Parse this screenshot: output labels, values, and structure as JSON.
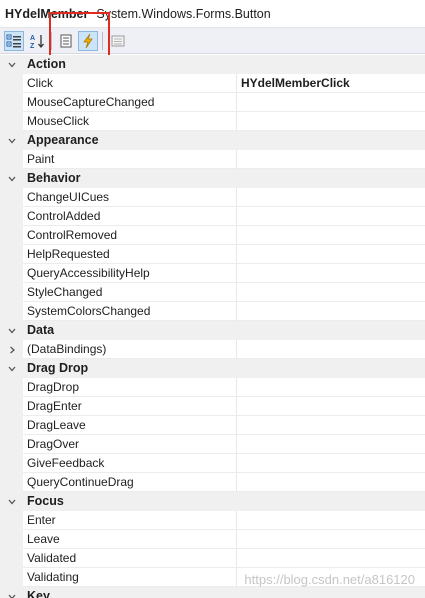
{
  "header": {
    "object_name": "HYdelMember",
    "object_type": "System.Windows.Forms.Button"
  },
  "toolbar": {
    "buttons": [
      {
        "icon": "categorized-icon",
        "checked": true
      },
      {
        "icon": "alphabetical-icon",
        "checked": false
      },
      {
        "icon": "properties-icon",
        "checked": false
      },
      {
        "icon": "events-lightning-icon",
        "checked": true
      },
      {
        "icon": "property-pages-icon",
        "checked": false
      }
    ]
  },
  "grid": {
    "categories": [
      {
        "name": "Action",
        "items": [
          {
            "name": "Click",
            "value": "HYdelMemberClick"
          },
          {
            "name": "MouseCaptureChanged",
            "value": ""
          },
          {
            "name": "MouseClick",
            "value": ""
          }
        ]
      },
      {
        "name": "Appearance",
        "items": [
          {
            "name": "Paint",
            "value": ""
          }
        ]
      },
      {
        "name": "Behavior",
        "items": [
          {
            "name": "ChangeUICues",
            "value": ""
          },
          {
            "name": "ControlAdded",
            "value": ""
          },
          {
            "name": "ControlRemoved",
            "value": ""
          },
          {
            "name": "HelpRequested",
            "value": ""
          },
          {
            "name": "QueryAccessibilityHelp",
            "value": ""
          },
          {
            "name": "StyleChanged",
            "value": ""
          },
          {
            "name": "SystemColorsChanged",
            "value": ""
          }
        ]
      },
      {
        "name": "Data",
        "items": [
          {
            "name": "(DataBindings)",
            "value": "",
            "expandable": true
          }
        ]
      },
      {
        "name": "Drag Drop",
        "items": [
          {
            "name": "DragDrop",
            "value": ""
          },
          {
            "name": "DragEnter",
            "value": ""
          },
          {
            "name": "DragLeave",
            "value": ""
          },
          {
            "name": "DragOver",
            "value": ""
          },
          {
            "name": "GiveFeedback",
            "value": ""
          },
          {
            "name": "QueryContinueDrag",
            "value": ""
          }
        ]
      },
      {
        "name": "Focus",
        "items": [
          {
            "name": "Enter",
            "value": ""
          },
          {
            "name": "Leave",
            "value": ""
          },
          {
            "name": "Validated",
            "value": ""
          },
          {
            "name": "Validating",
            "value": ""
          }
        ]
      },
      {
        "name": "Key",
        "items": []
      }
    ]
  },
  "watermark": "https://blog.csdn.net/a816120",
  "colors": {
    "highlight_box": "#e02b20",
    "category_bg": "#f0f0f0",
    "toolbar_bg": "#eef0f5"
  }
}
